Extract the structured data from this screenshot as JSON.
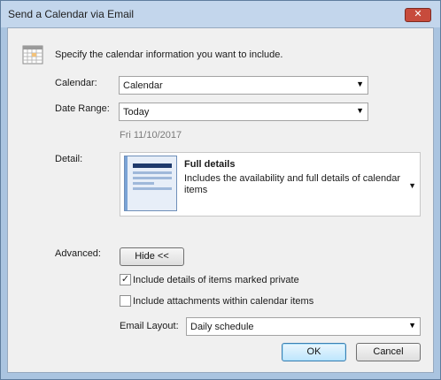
{
  "window": {
    "title": "Send a Calendar via Email",
    "close_glyph": "✕"
  },
  "intro": {
    "text": "Specify the calendar information you want to include.",
    "icon": "calendar-icon"
  },
  "calendar": {
    "label": "Calendar:",
    "value": "Calendar"
  },
  "date_range": {
    "label": "Date Range:",
    "value": "Today",
    "hint": "Fri 11/10/2017"
  },
  "detail": {
    "label": "Detail:",
    "title": "Full details",
    "description": "Includes the availability and full details of calendar items",
    "icon": "document-details-icon"
  },
  "advanced": {
    "label": "Advanced:",
    "toggle_label": "Hide <<"
  },
  "options": {
    "private": {
      "label": "Include details of items marked private",
      "checked": true
    },
    "attachments": {
      "label": "Include attachments within calendar items",
      "checked": false
    }
  },
  "email_layout": {
    "label": "Email Layout:",
    "value": "Daily schedule"
  },
  "buttons": {
    "ok": "OK",
    "cancel": "Cancel"
  },
  "colors": {
    "titlebar": "#c3d6ec",
    "frame": "#aac4e0",
    "close": "#c74b3c",
    "accent": "#3c7fb1"
  }
}
